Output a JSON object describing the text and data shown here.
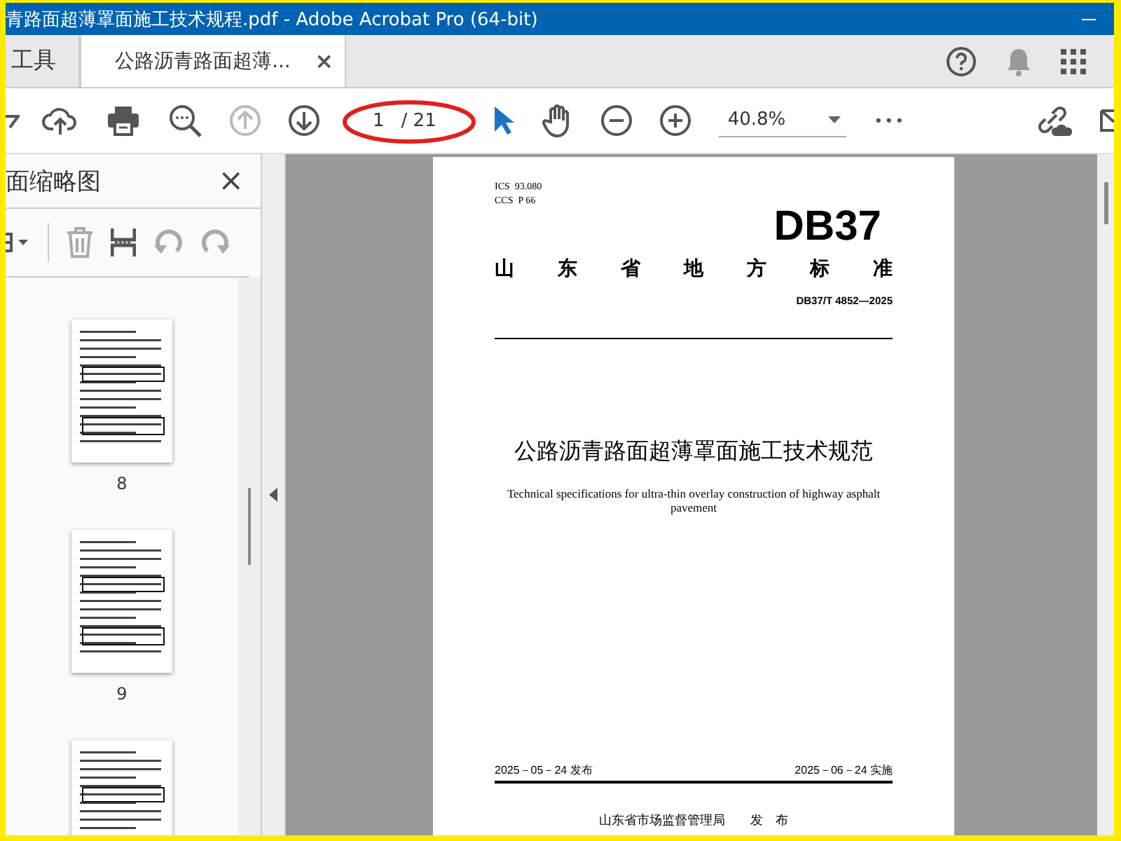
{
  "window": {
    "title": "青路面超薄罩面施工技术规程.pdf - Adobe Acrobat Pro (64-bit)"
  },
  "tabs": [
    {
      "label": "工具",
      "selected": false
    },
    {
      "label": "公路沥青路面超薄...",
      "selected": true,
      "close": "×"
    }
  ],
  "toolbar": {
    "page_current": "1",
    "page_total": "/ 21",
    "zoom": "40.8%",
    "more": "•••"
  },
  "sidebar": {
    "title": "面缩略图",
    "close": "×",
    "thumbnails": [
      {
        "kind": "page",
        "label": "8"
      },
      {
        "kind": "page",
        "label": "9"
      },
      {
        "kind": "cut"
      }
    ]
  },
  "document": {
    "ics": "ICS  93.080",
    "ccs": "CCS  P 66",
    "logo": "DB37",
    "heading": "山东省地方标准",
    "code": "DB37/T 4852—2025",
    "title": "公路沥青路面超薄罩面施工技术规范",
    "title_en": "Technical specifications for ultra-thin overlay construction of highway asphalt pavement",
    "issue_date": "2025－05－24 发布",
    "effective_date": "2025－06－24 实施",
    "publisher": "山东省市场监督管理局　　发　布"
  }
}
